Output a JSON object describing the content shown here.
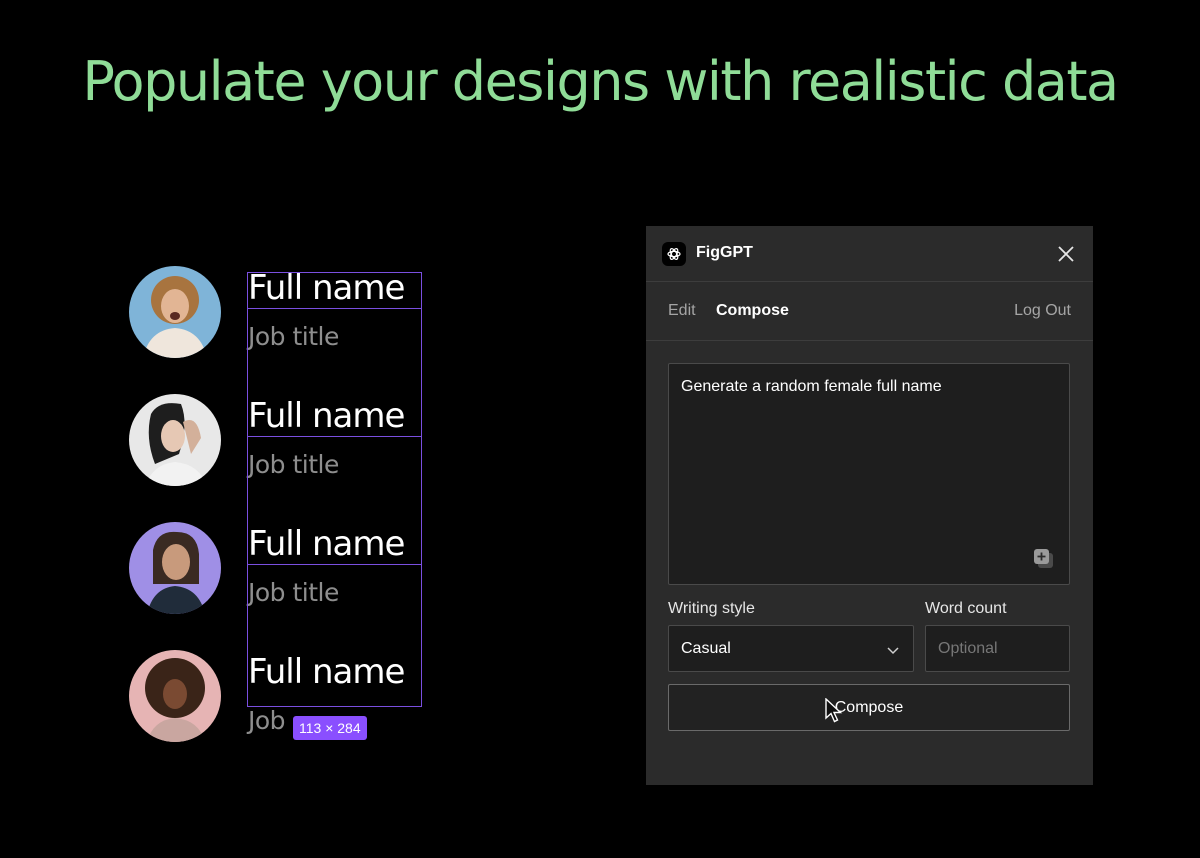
{
  "headline": "Populate your designs with realistic data",
  "users": [
    {
      "name": "Full name",
      "job": "Job title"
    },
    {
      "name": "Full name",
      "job": "Job title"
    },
    {
      "name": "Full name",
      "job": "Job title"
    },
    {
      "name": "Full name",
      "job": "Job"
    }
  ],
  "selection": {
    "dimensions": "113 × 284",
    "color": "#8a4fff"
  },
  "colors": {
    "headline": "#8fdc97",
    "panel_bg": "#2b2b2b",
    "selection": "#7a4fe0"
  },
  "panel": {
    "title": "FigGPT",
    "app_icon": "figgpt-logo-icon",
    "close_icon": "close-icon",
    "tabs": [
      {
        "label": "Edit",
        "active": false
      },
      {
        "label": "Compose",
        "active": true
      }
    ],
    "logout_label": "Log Out",
    "prompt": "Generate a random female full name",
    "add_icon": "add-variable-icon",
    "writing_style": {
      "label": "Writing style",
      "value": "Casual"
    },
    "word_count": {
      "label": "Word count",
      "value": "",
      "placeholder": "Optional"
    },
    "compose_button": "Compose"
  }
}
